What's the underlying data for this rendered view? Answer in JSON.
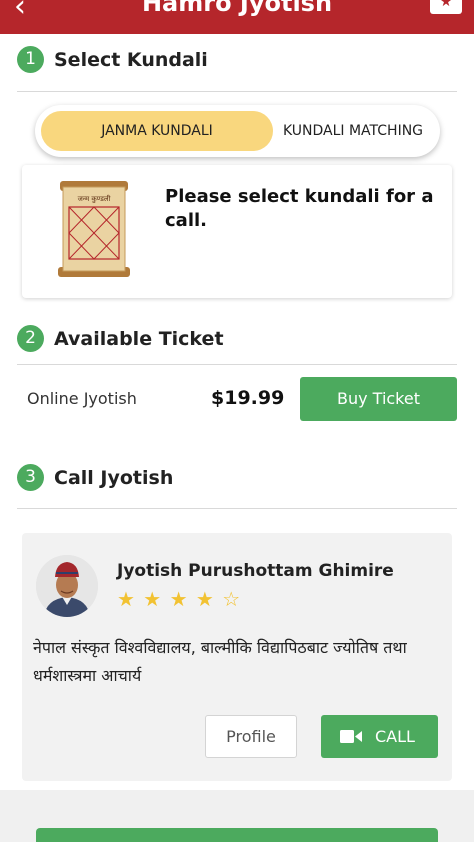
{
  "header": {
    "title": "Hamro Jyotish",
    "back_icon": "chevron-left-icon",
    "action_icon": "star-icon"
  },
  "steps": [
    {
      "number": "1",
      "label": "Select Kundali"
    },
    {
      "number": "2",
      "label": "Available Ticket"
    },
    {
      "number": "3",
      "label": "Call Jyotish"
    }
  ],
  "kundali_tabs": {
    "selected": "JANMA KUNDALI",
    "other": "KUNDALI MATCHING"
  },
  "kundali_card": {
    "scroll_caption": "जन्म कुण्डली",
    "message": "Please select kundali for a call."
  },
  "ticket": {
    "name": "Online Jyotish",
    "price": "$19.99",
    "buy_label": "Buy Ticket"
  },
  "astrologer": {
    "name": "Jyotish Purushottam Ghimire",
    "rating": 4.5,
    "description": "नेपाल संस्कृत विश्वविद्यालय, बाल्मीकि विद्यापिठबाट ज्योतिष तथा धर्मशास्त्रमा आचार्य",
    "profile_label": "Profile",
    "call_label": "CALL"
  },
  "colors": {
    "header": "#b5262b",
    "accent_green": "#4caa5e",
    "selected_tab": "#f9d77e",
    "star": "#f2c232"
  }
}
